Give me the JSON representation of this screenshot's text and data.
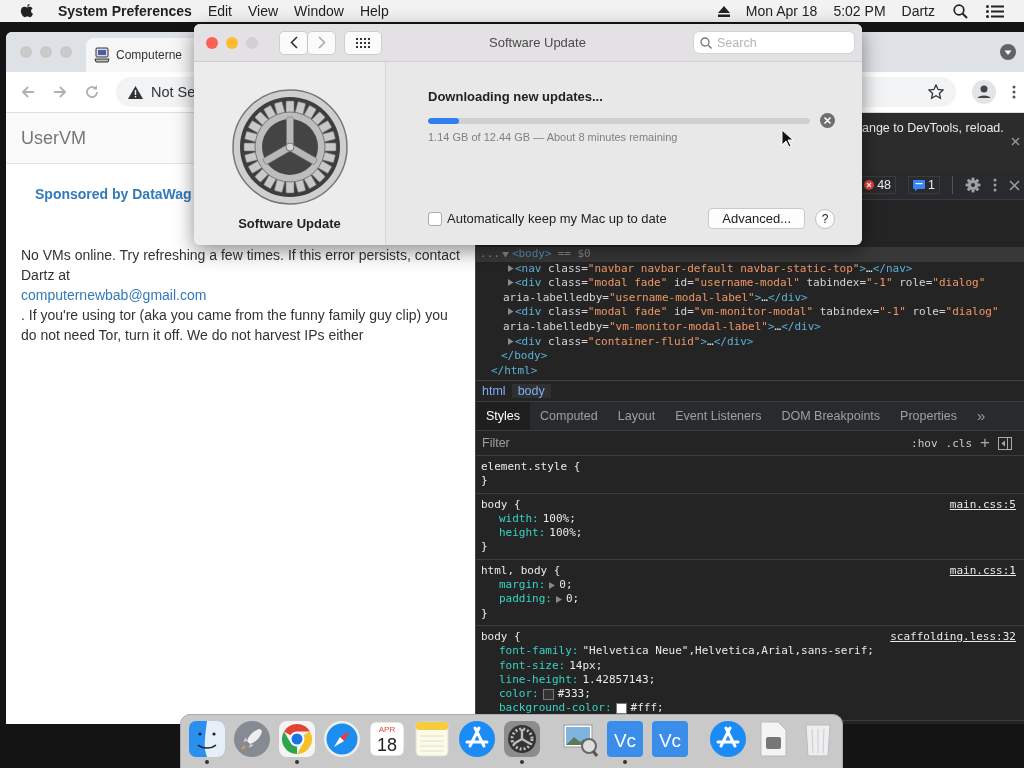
{
  "menu_bar": {
    "app": "System Preferences",
    "menus": [
      "Edit",
      "View",
      "Window",
      "Help"
    ],
    "date": "Mon Apr 18",
    "time": "5:02 PM",
    "user": "Dartz"
  },
  "browser": {
    "tab_title": "Computerne",
    "address": "Not Se",
    "page": {
      "brand": "UserVM",
      "sponsor": "Sponsored by DataWag",
      "message_start": "No VMs online. Try refreshing a few times. If this error persists, contact Dartz at",
      "email": "computernewbab@gmail.com",
      "message_end": ". If you're using tor (aka you came from the funny family guy clip) you do not need Tor, turn it off. We do not harvest IPs either"
    }
  },
  "devtools": {
    "notice": "ange to DevTools, reload.",
    "error_count": "48",
    "message_count": "1",
    "elements": {
      "body": {
        "prefix": "...",
        "tag": "<body>",
        "marker": "== $0",
        "expanded": true,
        "selected": true,
        "children": [
          {
            "expanded": false,
            "lines": [
              [
                {
                  "kind": "tag",
                  "text": "<nav"
                },
                {
                  "kind": "attr",
                  "text": " class="
                },
                {
                  "kind": "value",
                  "text": "\"navbar navbar-default navbar-static-top\""
                },
                {
                  "kind": "tag",
                  "text": ">"
                },
                {
                  "kind": "text",
                  "text": "…"
                },
                {
                  "kind": "tag",
                  "text": "</nav>"
                }
              ]
            ]
          },
          {
            "expanded": false,
            "lines": [
              [
                {
                  "kind": "tag",
                  "text": "<div"
                },
                {
                  "kind": "attr",
                  "text": " class="
                },
                {
                  "kind": "value",
                  "text": "\"modal fade\""
                },
                {
                  "kind": "attr",
                  "text": " id="
                },
                {
                  "kind": "value",
                  "text": "\"username-modal\""
                },
                {
                  "kind": "attr",
                  "text": " tabindex="
                },
                {
                  "kind": "value",
                  "text": "\"-1\""
                },
                {
                  "kind": "attr",
                  "text": " role="
                },
                {
                  "kind": "value",
                  "text": "\"dialog\""
                }
              ],
              [
                {
                  "kind": "attr",
                  "text": "aria-labelledby="
                },
                {
                  "kind": "value",
                  "text": "\"username-modal-label\""
                },
                {
                  "kind": "tag",
                  "text": ">"
                },
                {
                  "kind": "text",
                  "text": "…"
                },
                {
                  "kind": "tag",
                  "text": "</div>"
                }
              ]
            ]
          },
          {
            "expanded": false,
            "lines": [
              [
                {
                  "kind": "tag",
                  "text": "<div"
                },
                {
                  "kind": "attr",
                  "text": " class="
                },
                {
                  "kind": "value",
                  "text": "\"modal fade\""
                },
                {
                  "kind": "attr",
                  "text": " id="
                },
                {
                  "kind": "value",
                  "text": "\"vm-monitor-modal\""
                },
                {
                  "kind": "attr",
                  "text": " tabindex="
                },
                {
                  "kind": "value",
                  "text": "\"-1\""
                },
                {
                  "kind": "attr",
                  "text": " role="
                },
                {
                  "kind": "value",
                  "text": "\"dialog\""
                }
              ],
              [
                {
                  "kind": "attr",
                  "text": "aria-labelledby="
                },
                {
                  "kind": "value",
                  "text": "\"vm-monitor-modal-label\""
                },
                {
                  "kind": "tag",
                  "text": ">"
                },
                {
                  "kind": "text",
                  "text": "…"
                },
                {
                  "kind": "tag",
                  "text": "</div>"
                }
              ]
            ]
          },
          {
            "expanded": false,
            "lines": [
              [
                {
                  "kind": "tag",
                  "text": "<div"
                },
                {
                  "kind": "attr",
                  "text": " class="
                },
                {
                  "kind": "value",
                  "text": "\"container-fluid\""
                },
                {
                  "kind": "tag",
                  "text": ">"
                },
                {
                  "kind": "text",
                  "text": "…"
                },
                {
                  "kind": "tag",
                  "text": "</div>"
                }
              ]
            ]
          }
        ],
        "closing": "</body>"
      },
      "closing": "</html>"
    },
    "breadcrumbs": [
      {
        "label": "html",
        "selected": false
      },
      {
        "label": "body",
        "selected": true
      }
    ],
    "tabs": [
      {
        "label": "Styles",
        "selected": true
      },
      {
        "label": "Computed",
        "selected": false
      },
      {
        "label": "Layout",
        "selected": false
      },
      {
        "label": "Event Listeners",
        "selected": false
      },
      {
        "label": "DOM Breakpoints",
        "selected": false
      },
      {
        "label": "Properties",
        "selected": false
      }
    ],
    "more_tabs": "»",
    "filter": {
      "placeholder": "Filter"
    },
    "toggles": [
      ":hov",
      ".cls"
    ],
    "add": "+",
    "rules": [
      {
        "selector": "element.style {",
        "close": "}"
      },
      {
        "selector": "body {",
        "source": "main.css:5",
        "close": "}",
        "declarations": [
          {
            "property": "width:",
            "value": "100%;"
          },
          {
            "property": "height:",
            "value": "100%;"
          }
        ]
      },
      {
        "selector": "html, body {",
        "source": "main.css:1",
        "close": "}",
        "declarations": [
          {
            "property": "margin:",
            "value": "0;",
            "expandable": true
          },
          {
            "property": "padding:",
            "value": "0;",
            "expandable": true
          }
        ]
      },
      {
        "selector": "body {",
        "source": "scaffolding.less:32",
        "declarations": [
          {
            "property": "font-family:",
            "value": "\"Helvetica Neue\",Helvetica,Arial,sans-serif;"
          },
          {
            "property": "font-size:",
            "value": "14px;"
          },
          {
            "property": "line-height:",
            "value": "1.42857143;"
          },
          {
            "property": "color:",
            "value": "#333;",
            "color": "#333333"
          },
          {
            "property": "background-color:",
            "value": "#fff;",
            "color": "#ffffff"
          }
        ]
      }
    ]
  },
  "dialog": {
    "title": "Software Update",
    "search": {
      "placeholder": "Search"
    },
    "pane_label": "Software Update",
    "status": "Downloading new updates...",
    "progress": {
      "level": 0.08
    },
    "detail": "1.14 GB of 12.44 GB — About 8 minutes remaining",
    "auto_update": {
      "label": "Automatically keep my Mac up to date",
      "checked": false
    },
    "advanced": "Advanced...",
    "help": "?"
  },
  "dock": [
    {
      "kind": "finder",
      "running": true
    },
    {
      "kind": "launchpad",
      "running": false
    },
    {
      "kind": "chrome",
      "running": true
    },
    {
      "kind": "safari",
      "running": false
    },
    {
      "kind": "calendar",
      "month": "APR",
      "day": "18",
      "running": false
    },
    {
      "kind": "notes",
      "running": false
    },
    {
      "kind": "appstore",
      "running": false
    },
    {
      "kind": "sysprefs",
      "running": true
    },
    {
      "kind": "separator"
    },
    {
      "kind": "preview",
      "running": false
    },
    {
      "kind": "vnc",
      "text": "Vc",
      "running": true
    },
    {
      "kind": "vnc",
      "text": "Vc",
      "running": false
    },
    {
      "kind": "separator"
    },
    {
      "kind": "appstore",
      "running": false
    },
    {
      "kind": "document",
      "running": false
    },
    {
      "kind": "trash",
      "running": false
    }
  ]
}
